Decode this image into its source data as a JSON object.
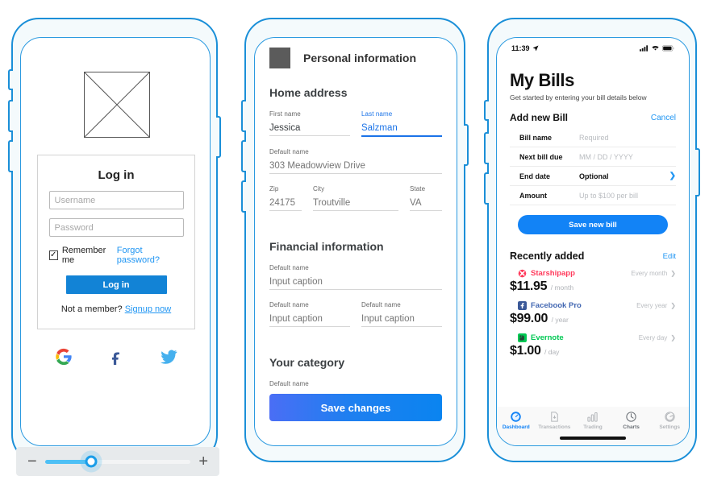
{
  "phone1": {
    "name": "login-screen",
    "image_placeholder": "image-placeholder-box",
    "card": {
      "title": "Log in",
      "username_placeholder": "Username",
      "password_placeholder": "Password",
      "username_value": "",
      "password_value": "",
      "remember_label": "Remember me",
      "remember_checked": true,
      "forgot_label": "Forgot password?",
      "login_button": "Log in",
      "not_member_prefix": "Not a member?",
      "signup_label": "Signup now"
    },
    "socials": [
      {
        "name": "google",
        "glyph": "G"
      },
      {
        "name": "facebook",
        "glyph": "f"
      },
      {
        "name": "twitter",
        "glyph": "bird"
      }
    ],
    "zoom_bar": {
      "minus": "−",
      "plus": "+",
      "value_percent": 32
    }
  },
  "phone2": {
    "name": "personal-information-form",
    "header_title": "Personal information",
    "sections": [
      {
        "title": "Home address",
        "rows": [
          [
            {
              "label": "First name",
              "value": "Jessica",
              "placeholder": "",
              "state": "filled"
            },
            {
              "label": "Last name",
              "value": "Salzman",
              "placeholder": "",
              "state": "active"
            }
          ],
          [
            {
              "label": "Default name",
              "value": "",
              "placeholder": "303 Meadowview Drive",
              "state": "placeholder"
            }
          ],
          [
            {
              "label": "Zip",
              "value": "",
              "placeholder": "24175",
              "state": "placeholder"
            },
            {
              "label": "City",
              "value": "",
              "placeholder": "Troutville",
              "state": "placeholder"
            },
            {
              "label": "State",
              "value": "",
              "placeholder": "VA",
              "state": "placeholder"
            }
          ]
        ]
      },
      {
        "title": "Financial information",
        "rows": [
          [
            {
              "label": "Default name",
              "value": "",
              "placeholder": "Input caption",
              "state": "placeholder"
            }
          ],
          [
            {
              "label": "Default name",
              "value": "",
              "placeholder": "Input caption",
              "state": "placeholder"
            },
            {
              "label": "Default name",
              "value": "",
              "placeholder": "Input caption",
              "state": "placeholder"
            }
          ]
        ]
      },
      {
        "title": "Your category",
        "rows": [
          [
            {
              "label": "Default name",
              "value": "",
              "placeholder": "",
              "state": "placeholder"
            }
          ]
        ]
      }
    ],
    "save_button": "Save changes"
  },
  "phone3": {
    "name": "my-bills-screen",
    "status_bar": {
      "time": "11:39",
      "location_icon": "location-arrow-icon",
      "signal_icon": "cellular-signal-icon",
      "wifi_icon": "wifi-icon",
      "battery_icon": "battery-icon"
    },
    "title": "My Bills",
    "subtitle": "Get started by entering your bill details below",
    "add_new": {
      "title": "Add new Bill",
      "cancel_label": "Cancel",
      "fields": [
        {
          "label": "Bill name",
          "value": "Required",
          "style": "placeholder",
          "chevron": false
        },
        {
          "label": "Next bill due",
          "value": "MM / DD / YYYY",
          "style": "placeholder",
          "chevron": false
        },
        {
          "label": "End date",
          "value": "Optional",
          "style": "dark",
          "chevron": true
        },
        {
          "label": "Amount",
          "value": "Up to $100 per bill",
          "style": "placeholder",
          "chevron": false
        }
      ],
      "save_button": "Save new bill"
    },
    "recent": {
      "title": "Recently added",
      "edit_label": "Edit",
      "items": [
        {
          "brand": "Starshipapp",
          "color": "#ff3b5c",
          "icon": "starshipapp-icon",
          "frequency": "Every month",
          "amount": "$11.95",
          "period": "/ month"
        },
        {
          "brand": "Facebook Pro",
          "color": "#4267b2",
          "icon": "facebook-icon",
          "frequency": "Every year",
          "amount": "$99.00",
          "period": "/ year"
        },
        {
          "brand": "Evernote",
          "color": "#00c853",
          "icon": "evernote-icon",
          "frequency": "Every day",
          "amount": "$1.00",
          "period": "/ day"
        }
      ]
    },
    "tabs": [
      {
        "label": "Dashboard",
        "icon": "dashboard-icon",
        "state": "active"
      },
      {
        "label": "Transactions",
        "icon": "transactions-icon",
        "state": "inactive"
      },
      {
        "label": "Trading",
        "icon": "trading-icon",
        "state": "inactive"
      },
      {
        "label": "Charts",
        "icon": "charts-icon",
        "state": "semi"
      },
      {
        "label": "Settings",
        "icon": "settings-icon",
        "state": "inactive"
      }
    ]
  }
}
